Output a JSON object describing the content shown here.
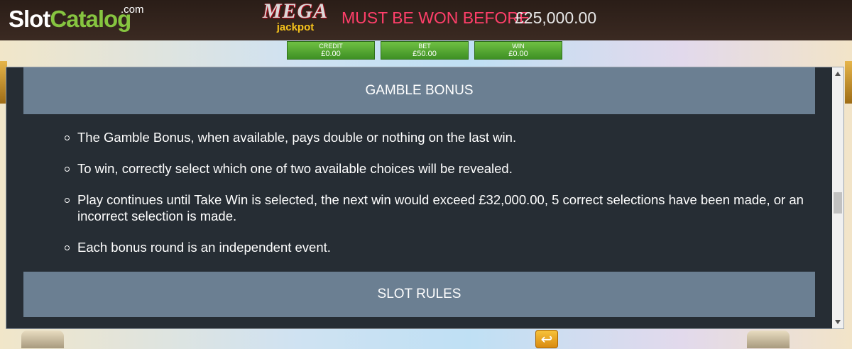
{
  "header": {
    "logo": {
      "slot": "Slot",
      "catalog": "Catalog",
      "com": ".com"
    },
    "mega_jackpot": {
      "mega": "MEGA",
      "jackpot": "jackpot"
    },
    "jackpot_message": "MUST BE WON BEFORE",
    "jackpot_amount": "£25,000.00"
  },
  "balances": [
    {
      "label": "CREDIT",
      "value": "£0.00"
    },
    {
      "label": "BET",
      "value": "£50.00"
    },
    {
      "label": "WIN",
      "value": "£0.00"
    }
  ],
  "panel": {
    "section_title": "GAMBLE BONUS",
    "rules": [
      "The Gamble Bonus, when available, pays double or nothing on the last win.",
      "To win, correctly select which one of two available choices will be revealed.",
      "Play continues until Take Win is selected, the next win would exceed £32,000.00, 5 correct selections have been made, or an incorrect selection is made.",
      "Each bonus round is an independent event."
    ],
    "next_section_title": "SLOT RULES"
  },
  "icons": {
    "back": "return-arrow-icon",
    "scroll_up": "chevron-up-icon",
    "scroll_down": "chevron-down-icon"
  },
  "colors": {
    "panel_bg": "#262d34",
    "section_header_bg": "#6b7f92",
    "balance_green": "#4ea52e",
    "jackpot_pink": "#ff3f6a",
    "logo_green": "#86c440",
    "back_button_orange": "#f0a522"
  }
}
